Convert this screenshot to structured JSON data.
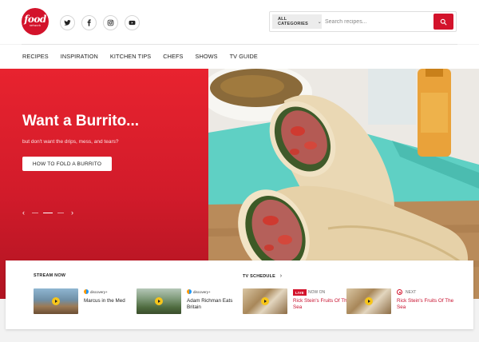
{
  "brand": {
    "logo_line1": "food",
    "logo_line2": "network",
    "accent_color": "#d3132b"
  },
  "socials": [
    {
      "name": "twitter"
    },
    {
      "name": "facebook"
    },
    {
      "name": "instagram"
    },
    {
      "name": "youtube"
    }
  ],
  "search": {
    "category_label": "ALL CATEGORIES",
    "placeholder": "Search recipes...",
    "value": ""
  },
  "nav": {
    "items": [
      "RECIPES",
      "INSPIRATION",
      "KITCHEN TIPS",
      "CHEFS",
      "SHOWS",
      "TV GUIDE"
    ]
  },
  "hero": {
    "title": "Want a Burrito...",
    "subtitle": "but don't want the drips, mess, and tears?",
    "button_label": "HOW TO FOLD A BURRITO",
    "background_color": "#e8232f",
    "slide_count": 3,
    "active_slide": 2
  },
  "stream": {
    "heading": "STREAM NOW",
    "items": [
      {
        "channel": "discovery+",
        "title": "Marcus in the Med"
      },
      {
        "channel": "discovery+",
        "title": "Adam Richman Eats Britain"
      }
    ]
  },
  "schedule": {
    "heading": "TV SCHEDULE",
    "heading_arrow": "›",
    "items": [
      {
        "badge": "LIVE",
        "status": "NOW ON",
        "title": "Rick Stein's Fruits Of The Sea"
      },
      {
        "status": "NEXT",
        "title": "Rick Stein's Fruits Of The Sea"
      }
    ]
  }
}
